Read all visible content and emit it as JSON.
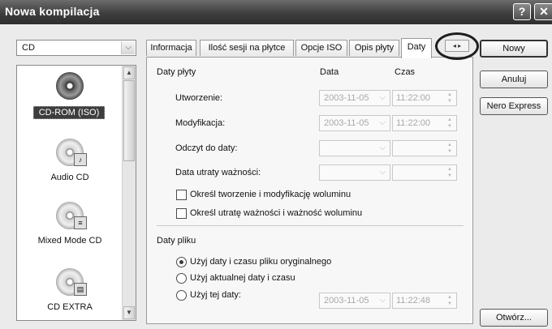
{
  "window": {
    "title": "Nowa kompilacja",
    "help_glyph": "?",
    "close_glyph": "✕"
  },
  "media_combo": {
    "value": "CD"
  },
  "compilation_types": [
    {
      "label": "CD-ROM (ISO)",
      "icon": "cd-rom-disc-icon",
      "selected": true
    },
    {
      "label": "Audio CD",
      "icon": "audio-cd-icon",
      "selected": false
    },
    {
      "label": "Mixed Mode CD",
      "icon": "mixed-mode-cd-icon",
      "selected": false
    },
    {
      "label": "CD EXTRA",
      "icon": "cd-extra-icon",
      "selected": false
    }
  ],
  "tabs": [
    {
      "label": "Informacja",
      "active": false
    },
    {
      "label": "Ilość sesji na płytce",
      "active": false
    },
    {
      "label": "Opcje ISO",
      "active": false
    },
    {
      "label": "Opis płyty",
      "active": false
    },
    {
      "label": "Daty",
      "active": true
    }
  ],
  "tab_nav": {
    "left": "◂",
    "right": "▸"
  },
  "dates_tab": {
    "disc_dates_label": "Daty płyty",
    "col_date": "Data",
    "col_time": "Czas",
    "rows": [
      {
        "label": "Utworzenie:",
        "date": "2003-11-05",
        "time": "11:22:00"
      },
      {
        "label": "Modyfikacja:",
        "date": "2003-11-05",
        "time": "11:22:00"
      },
      {
        "label": "Odczyt do daty:",
        "date": "",
        "time": ""
      },
      {
        "label": "Data utraty ważności:",
        "date": "",
        "time": ""
      }
    ],
    "check_volume_dates": "Określ tworzenie i modyfikację woluminu",
    "check_expiry": "Określ utratę ważności i ważność woluminu",
    "file_dates_label": "Daty pliku",
    "radio_original": "Użyj daty i czasu pliku oryginalnego",
    "radio_current": "Użyj aktualnej daty i czasu",
    "radio_custom": "Użyj tej daty:",
    "custom_date": "2003-11-05",
    "custom_time": "11:22:48",
    "selected_radio": "original"
  },
  "buttons": {
    "new": "Nowy",
    "cancel": "Anuluj",
    "nero_express": "Nero Express",
    "open": "Otwórz..."
  },
  "glyphs": {
    "combo_arrow": "⌵",
    "spin_up": "▲",
    "spin_down": "▼",
    "scroll_up": "▲",
    "scroll_down": "▼"
  }
}
